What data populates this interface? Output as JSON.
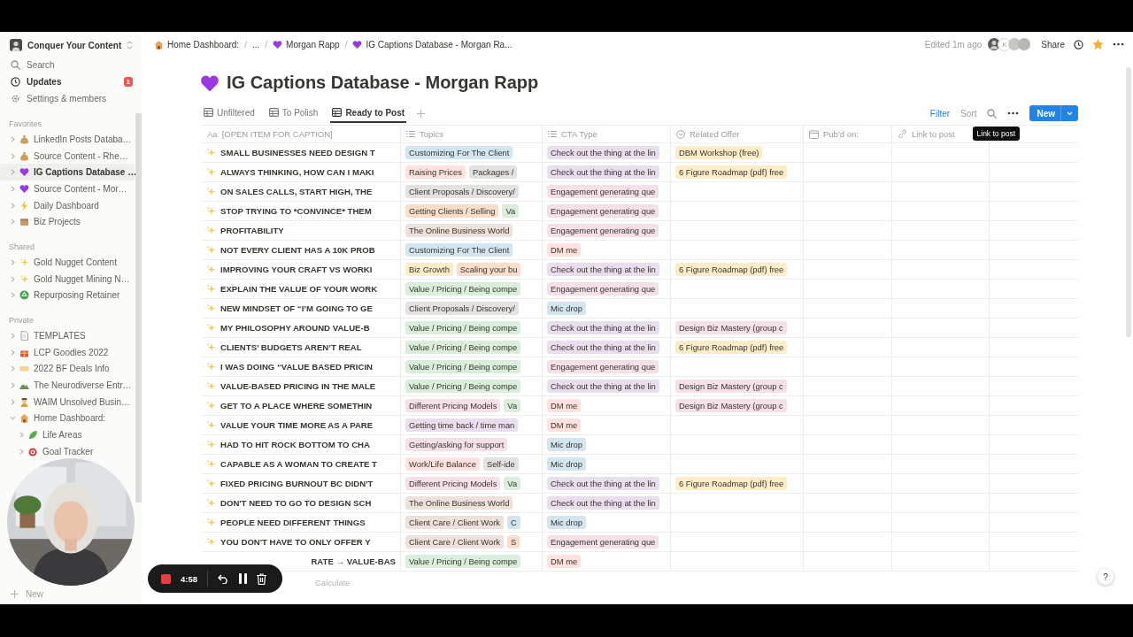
{
  "sidebar": {
    "workspace": "Conquer Your Content",
    "top_items": [
      {
        "label": "Search"
      },
      {
        "label": "Updates",
        "badge": "1"
      },
      {
        "label": "Settings & members"
      }
    ],
    "sections": [
      {
        "title": "Favorites",
        "items": [
          {
            "label": "LinkedIn Posts Databa…",
            "selected": false,
            "expanded": false
          },
          {
            "label": "Source Content - Rhe…",
            "selected": false,
            "expanded": false
          },
          {
            "label": "IG Captions Database …",
            "selected": true,
            "expanded": false
          },
          {
            "label": "Source Content - Mor…",
            "selected": false,
            "expanded": false
          },
          {
            "label": "Daily Dashboard",
            "selected": false,
            "expanded": false
          },
          {
            "label": "Biz Projects",
            "selected": false,
            "expanded": false
          }
        ]
      },
      {
        "title": "Shared",
        "items": [
          {
            "label": "Gold Nugget Content",
            "selected": false,
            "expanded": false
          },
          {
            "label": "Gold Nugget Mining N…",
            "selected": false,
            "expanded": false
          },
          {
            "label": "Repurposing Retainer",
            "selected": false,
            "expanded": false
          }
        ]
      },
      {
        "title": "Private",
        "items": [
          {
            "label": "TEMPLATES",
            "selected": false,
            "expanded": false
          },
          {
            "label": "LCP Goodies 2022",
            "selected": false,
            "expanded": false
          },
          {
            "label": "2022 BF Deals Info",
            "selected": false,
            "expanded": false
          },
          {
            "label": "The Neurodiverse Entr…",
            "selected": false,
            "expanded": false
          },
          {
            "label": "WAIM Unsolved Busin…",
            "selected": false,
            "expanded": false
          },
          {
            "label": "Home Dashboard:",
            "selected": false,
            "expanded": true,
            "children": [
              {
                "label": "Life Areas",
                "selected": false,
                "expanded": false
              },
              {
                "label": "Goal Tracker",
                "selected": false,
                "expanded": false
              }
            ]
          }
        ]
      }
    ],
    "new_page": "New"
  },
  "topbar": {
    "separator": "/",
    "breadcrumb": [
      {
        "label": "Home Dashboard:"
      },
      {
        "label": "..."
      },
      {
        "label": "Morgan Rapp"
      },
      {
        "label": "IG Captions Database - Morgan Ra..."
      }
    ],
    "edited": "Edited 1m ago",
    "avatar_initial": "K",
    "share": "Share"
  },
  "page": {
    "title": "IG Captions Database - Morgan Rapp",
    "views": [
      {
        "label": "Unfiltered",
        "selected": false
      },
      {
        "label": "To Polish",
        "selected": false
      },
      {
        "label": "Ready to Post",
        "selected": true
      }
    ],
    "actions": {
      "filter": "Filter",
      "sort": "Sort",
      "new": "New"
    }
  },
  "table": {
    "columns": [
      {
        "kind": "title",
        "icon_text": "Aa",
        "label": "[OPEN ITEM FOR CAPTION]"
      },
      {
        "kind": "multi_select",
        "label": "Topics"
      },
      {
        "kind": "multi_select",
        "label": "CTA Type"
      },
      {
        "kind": "relation",
        "label": "Related Offer"
      },
      {
        "kind": "date",
        "label": "Pub'd on:"
      },
      {
        "kind": "url",
        "label": "Link to post"
      }
    ],
    "tooltip": "Link to post",
    "rows": [
      {
        "title": "SMALL BUSINESSES NEED DESIGN T",
        "topics": [
          {
            "label": "Customizing For The Client",
            "color": "#d3e5ef"
          }
        ],
        "cta": [
          {
            "label": "Check out the thing at the lin",
            "color": "#e8deee"
          }
        ],
        "offer": [
          {
            "label": "DBM Workshop (free)",
            "color": "#fdecc8"
          }
        ]
      },
      {
        "title": "ALWAYS THINKING, HOW CAN I MAKI",
        "topics": [
          {
            "label": "Raising Prices",
            "color": "#ffe2dd"
          },
          {
            "label": "Packages /",
            "color": "#e3e2e0"
          }
        ],
        "cta": [
          {
            "label": "Check out the thing at the lin",
            "color": "#e8deee"
          }
        ],
        "offer": [
          {
            "label": "6 Figure Roadmap (pdf) free",
            "color": "#fdecc8"
          }
        ]
      },
      {
        "title": "ON SALES CALLS, START HIGH, THE",
        "topics": [
          {
            "label": "Client Proposals / Discovery/",
            "color": "#e3e2e0"
          }
        ],
        "cta": [
          {
            "label": "Engagement generating que",
            "color": "#f5e0e9"
          }
        ]
      },
      {
        "title": "STOP TRYING TO *CONVINCE* THEM",
        "topics": [
          {
            "label": "Getting Clients / Selling",
            "color": "#fadec9"
          },
          {
            "label": "Va",
            "color": "#dbeddb"
          }
        ],
        "cta": [
          {
            "label": "Engagement generating que",
            "color": "#f5e0e9"
          }
        ]
      },
      {
        "title": "PROFITABILITY",
        "topics": [
          {
            "label": "The Online Business World",
            "color": "#eee0da"
          }
        ],
        "cta": [
          {
            "label": "Engagement generating que",
            "color": "#f5e0e9"
          }
        ]
      },
      {
        "title": "NOT EVERY CLIENT HAS A 10K PROB",
        "topics": [
          {
            "label": "Customizing For The Client",
            "color": "#d3e5ef"
          }
        ],
        "cta": [
          {
            "label": "DM me",
            "color": "#ffe2dd"
          }
        ]
      },
      {
        "title": "IMPROVING YOUR CRAFT VS WORKI",
        "topics": [
          {
            "label": "Biz Growth",
            "color": "#fdecc8"
          },
          {
            "label": "Scaling your bu",
            "color": "#fadec9"
          }
        ],
        "cta": [
          {
            "label": "Check out the thing at the lin",
            "color": "#e8deee"
          }
        ],
        "offer": [
          {
            "label": "6 Figure Roadmap (pdf) free",
            "color": "#fdecc8"
          }
        ]
      },
      {
        "title": "EXPLAIN THE VALUE OF YOUR WORK",
        "topics": [
          {
            "label": "Value / Pricing / Being compe",
            "color": "#dbeddb"
          }
        ],
        "cta": [
          {
            "label": "Engagement generating que",
            "color": "#f5e0e9"
          }
        ]
      },
      {
        "title": "NEW MINDSET OF “I’M GOING TO GE",
        "topics": [
          {
            "label": "Client Proposals / Discovery/",
            "color": "#e3e2e0"
          }
        ],
        "cta": [
          {
            "label": "Mic drop",
            "color": "#d3e5ef"
          }
        ]
      },
      {
        "title": "MY PHILOSOPHY AROUND VALUE-B",
        "topics": [
          {
            "label": "Value / Pricing / Being compe",
            "color": "#dbeddb"
          }
        ],
        "cta": [
          {
            "label": "Check out the thing at the lin",
            "color": "#e8deee"
          }
        ],
        "offer": [
          {
            "label": "Design Biz Mastery (group c",
            "color": "#f5e0e9"
          }
        ]
      },
      {
        "title": "CLIENTS’ BUDGETS AREN’T REAL",
        "topics": [
          {
            "label": "Value / Pricing / Being compe",
            "color": "#dbeddb"
          }
        ],
        "cta": [
          {
            "label": "Check out the thing at the lin",
            "color": "#e8deee"
          }
        ],
        "offer": [
          {
            "label": "6 Figure Roadmap (pdf) free",
            "color": "#fdecc8"
          }
        ]
      },
      {
        "title": "I WAS DOING “VALUE BASED PRICIN",
        "topics": [
          {
            "label": "Value / Pricing / Being compe",
            "color": "#dbeddb"
          }
        ],
        "cta": [
          {
            "label": "Engagement generating que",
            "color": "#f5e0e9"
          }
        ]
      },
      {
        "title": "VALUE-BASED PRICING IN THE MALE",
        "topics": [
          {
            "label": "Value / Pricing / Being compe",
            "color": "#dbeddb"
          }
        ],
        "cta": [
          {
            "label": "Check out the thing at the lin",
            "color": "#e8deee"
          }
        ],
        "offer": [
          {
            "label": "Design Biz Mastery (group c",
            "color": "#f5e0e9"
          }
        ]
      },
      {
        "title": "GET TO A PLACE WHERE SOMETHIN",
        "topics": [
          {
            "label": "Different Pricing Models",
            "color": "#f5e0e9"
          },
          {
            "label": "Va",
            "color": "#dbeddb"
          }
        ],
        "cta": [
          {
            "label": "DM me",
            "color": "#ffe2dd"
          }
        ],
        "offer": [
          {
            "label": "Design Biz Mastery (group c",
            "color": "#f5e0e9"
          }
        ]
      },
      {
        "title": "VALUE YOUR TIME MORE AS A PARE",
        "topics": [
          {
            "label": "Getting time back / time man",
            "color": "#e8deee"
          }
        ],
        "cta": [
          {
            "label": "DM me",
            "color": "#ffe2dd"
          }
        ]
      },
      {
        "title": "HAD TO HIT ROCK BOTTOM TO CHA",
        "topics": [
          {
            "label": "Getting/asking for support",
            "color": "#f5e0e9"
          }
        ],
        "cta": [
          {
            "label": "Mic drop",
            "color": "#d3e5ef"
          }
        ]
      },
      {
        "title": "CAPABLE AS A WOMAN TO CREATE T",
        "topics": [
          {
            "label": "Work/Life Balance",
            "color": "#ffe2dd"
          },
          {
            "label": "Self-ide",
            "color": "#e3e2e0"
          }
        ],
        "cta": [
          {
            "label": "Mic drop",
            "color": "#d3e5ef"
          }
        ]
      },
      {
        "title": "FIXED PRICING BURNOUT BC DIDN'T",
        "topics": [
          {
            "label": "Different Pricing Models",
            "color": "#f5e0e9"
          },
          {
            "label": "Va",
            "color": "#dbeddb"
          }
        ],
        "cta": [
          {
            "label": "Check out the thing at the lin",
            "color": "#e8deee"
          }
        ],
        "offer": [
          {
            "label": "6 Figure Roadmap (pdf) free",
            "color": "#fdecc8"
          }
        ]
      },
      {
        "title": "DON'T NEED TO GO TO DESIGN SCH",
        "topics": [
          {
            "label": "The Online Business World",
            "color": "#eee0da"
          }
        ],
        "cta": [
          {
            "label": "Check out the thing at the lin",
            "color": "#e8deee"
          }
        ]
      },
      {
        "title": "PEOPLE NEED DIFFERENT THINGS",
        "topics": [
          {
            "label": "Client Care / Client Work",
            "color": "#eee0da"
          },
          {
            "label": "C",
            "color": "#d3e5ef"
          }
        ],
        "cta": [
          {
            "label": "Mic drop",
            "color": "#d3e5ef"
          }
        ]
      },
      {
        "title": "YOU DON'T HAVE TO ONLY OFFER Y",
        "topics": [
          {
            "label": "Client Care / Client Work",
            "color": "#eee0da"
          },
          {
            "label": "S",
            "color": "#fadec9"
          }
        ],
        "cta": [
          {
            "label": "Engagement generating que",
            "color": "#f5e0e9"
          }
        ]
      },
      {
        "title": "RATE → VALUE-BAS",
        "covered": true,
        "topics": [
          {
            "label": "Value / Pricing / Being compe",
            "color": "#dbeddb"
          }
        ],
        "cta": [
          {
            "label": "DM me",
            "color": "#ffe2dd"
          }
        ]
      }
    ],
    "footer": "Calculate"
  },
  "recorder": {
    "time": "4:58"
  },
  "help": "?"
}
